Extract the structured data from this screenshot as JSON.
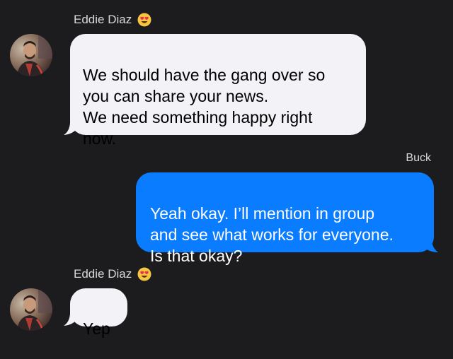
{
  "conversation": {
    "groups": [
      {
        "sender_name": "Eddie Diaz",
        "sender_emoji": "heart-eyes-emoji",
        "messages": [
          "We should have the gang over so\nyou can share your news.\nWe need something happy right\nnow."
        ]
      },
      {
        "sender_name": "Buck",
        "messages": [
          "Yeah okay. I’ll mention in group\nand see what works for everyone.\nIs that okay?"
        ]
      },
      {
        "sender_name": "Eddie Diaz",
        "sender_emoji": "heart-eyes-emoji",
        "messages": [
          "Yep"
        ]
      }
    ]
  },
  "colors": {
    "background": "#1c1c1e",
    "incoming_bubble": "#f2f2f7",
    "outgoing_bubble": "#0a7cff",
    "sender_text": "#d8d8dc"
  }
}
